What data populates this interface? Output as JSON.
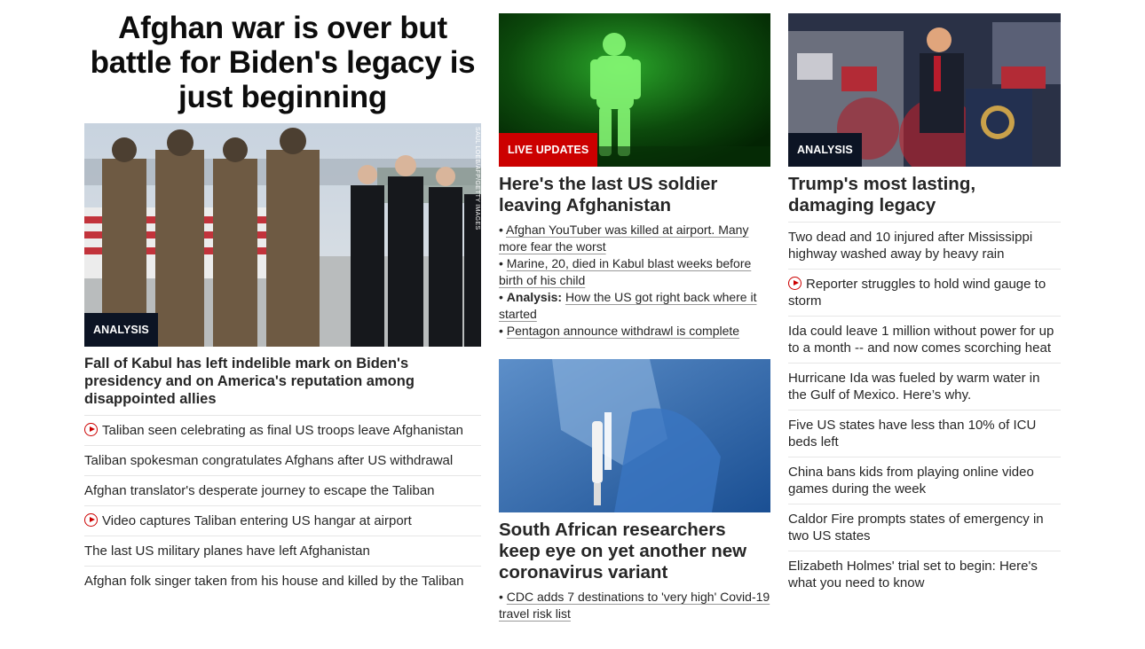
{
  "col1": {
    "headline": "Afghan war is over but battle for Biden's legacy is just beginning",
    "image_label": "ANALYSIS",
    "image_credit": "SAUL LOEB/AFP/GETTY IMAGES",
    "card_title": "Fall of Kabul has left indelible mark on Biden's presidency and on America's reputation among disappointed allies",
    "items": [
      {
        "text": "Taliban seen celebrating as final US troops leave Afghanistan",
        "video": true
      },
      {
        "text": "Taliban spokesman congratulates Afghans after US withdrawal",
        "video": false
      },
      {
        "text": "Afghan translator's desperate journey to escape the Taliban",
        "video": false
      },
      {
        "text": "Video captures Taliban entering US hangar at airport",
        "video": true
      },
      {
        "text": "The last US military planes have left Afghanistan",
        "video": false
      },
      {
        "text": "Afghan folk singer taken from his house and killed by the Taliban",
        "video": false
      }
    ]
  },
  "col2": {
    "story1": {
      "image_label": "LIVE UPDATES",
      "title": "Here's the last US soldier leaving Afghanistan",
      "bullets": [
        {
          "prefix": "",
          "text": "Afghan YouTuber was killed at airport. Many more fear the worst"
        },
        {
          "prefix": "",
          "text": "Marine, 20, died in Kabul blast weeks before birth of his child"
        },
        {
          "prefix": "Analysis:",
          "text": "How the US got right back where it started"
        },
        {
          "prefix": "",
          "text": "Pentagon announce withdrawl is complete"
        }
      ]
    },
    "story2": {
      "title": "South African researchers keep eye on yet another new coronavirus variant",
      "bullets": [
        {
          "prefix": "",
          "text": "CDC adds 7 destinations to 'very high' Covid-19 travel risk list"
        }
      ]
    }
  },
  "col3": {
    "image_label": "ANALYSIS",
    "title": "Trump's most lasting, damaging legacy",
    "items": [
      {
        "text": "Two dead and 10 injured after Mississippi highway washed away by heavy rain",
        "video": false
      },
      {
        "text": "Reporter struggles to hold wind gauge to storm",
        "video": true
      },
      {
        "text": "Ida could leave 1 million without power for up to a month -- and now comes scorching heat",
        "video": false
      },
      {
        "text": "Hurricane Ida was fueled by warm water in the Gulf of Mexico. Here’s why.",
        "video": false
      },
      {
        "text": "Five US states have less than 10% of ICU beds left",
        "video": false
      },
      {
        "text": "China bans kids from playing online video games during the week",
        "video": false
      },
      {
        "text": "Caldor Fire prompts states of emergency in two US states",
        "video": false
      },
      {
        "text": "Elizabeth Holmes' trial set to begin: Here's what you need to know",
        "video": false
      }
    ]
  },
  "colors": {
    "accent_red": "#cc0000",
    "label_dark": "#0c1424",
    "text": "#262626"
  }
}
